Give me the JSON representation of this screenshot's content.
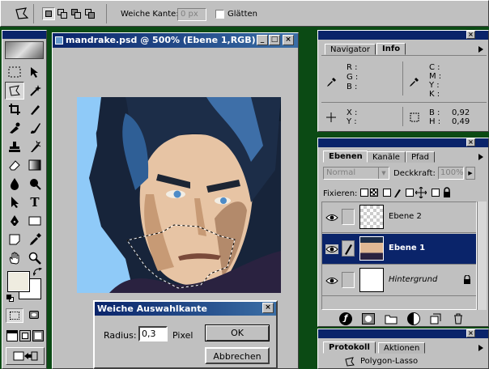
{
  "optionsbar": {
    "feather_label": "Weiche Kante:",
    "feather_value": "0 px",
    "antialias_label": "Glätten"
  },
  "document": {
    "title": "mandrake.psd @ 500% (Ebene 1,RGB)"
  },
  "dialog": {
    "title": "Weiche Auswahlkante",
    "radius_label": "Radius:",
    "radius_value": "0,3",
    "unit": "Pixel",
    "ok": "OK",
    "cancel": "Abbrechen"
  },
  "info_panel": {
    "tabs": [
      "Navigator",
      "Info"
    ],
    "rgb": [
      "R :",
      "G :",
      "B :"
    ],
    "cmyk": [
      "C :",
      "M :",
      "Y :",
      "K :"
    ],
    "xy": [
      "X :",
      "Y :"
    ],
    "bh": [
      "B :",
      "H :"
    ],
    "b_value": "0,92",
    "h_value": "0,49"
  },
  "layers_panel": {
    "tabs": [
      "Ebenen",
      "Kanäle",
      "Pfad"
    ],
    "blend_mode": "Normal",
    "opacity_label": "Deckkraft:",
    "opacity_value": "100%",
    "lock_label": "Fixieren:",
    "layers": [
      "Ebene 2",
      "Ebene 1",
      "Hintergrund"
    ]
  },
  "history_panel": {
    "tabs": [
      "Protokoll",
      "Aktionen"
    ],
    "item": "Polygon-Lasso"
  }
}
